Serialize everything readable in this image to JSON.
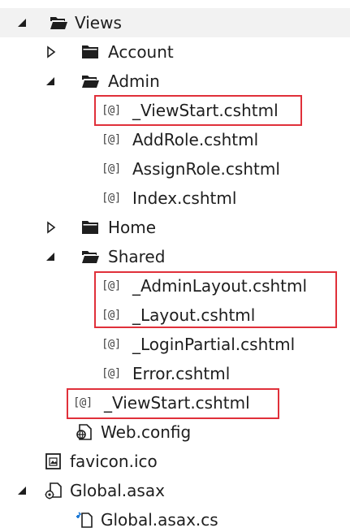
{
  "tree": {
    "views": {
      "label": "Views",
      "icon": "open-folder-icon",
      "expanded": true
    },
    "account": {
      "label": "Account",
      "icon": "folder-icon",
      "expanded": false
    },
    "admin": {
      "label": "Admin",
      "icon": "open-folder-icon",
      "expanded": true,
      "files": {
        "viewstart": "_ViewStart.cshtml",
        "addrole": "AddRole.cshtml",
        "assignrole": "AssignRole.cshtml",
        "index": "Index.cshtml"
      }
    },
    "home": {
      "label": "Home",
      "icon": "folder-icon",
      "expanded": false
    },
    "shared": {
      "label": "Shared",
      "icon": "open-folder-icon",
      "expanded": true,
      "files": {
        "adminlayout": "_AdminLayout.cshtml",
        "layout": "_Layout.cshtml",
        "loginpartial": "_LoginPartial.cshtml",
        "error": "Error.cshtml"
      }
    },
    "views_viewstart": "_ViewStart.cshtml",
    "web_config": {
      "label": "Web.config",
      "icon": "config-file-icon"
    },
    "favicon": {
      "label": "favicon.ico",
      "icon": "image-file-icon"
    },
    "global_asax": {
      "label": "Global.asax",
      "icon": "global-asax-icon",
      "expanded": true
    },
    "global_asax_cs": {
      "label": "Global.asax.cs",
      "icon": "csharp-file-icon"
    },
    "razor_icon_text": "[@]"
  },
  "colors": {
    "highlight_border": "#e0303a",
    "folder_fill": "#1e1e1e",
    "text": "#1e1e1e",
    "selected_row": "#f2f2f2"
  }
}
